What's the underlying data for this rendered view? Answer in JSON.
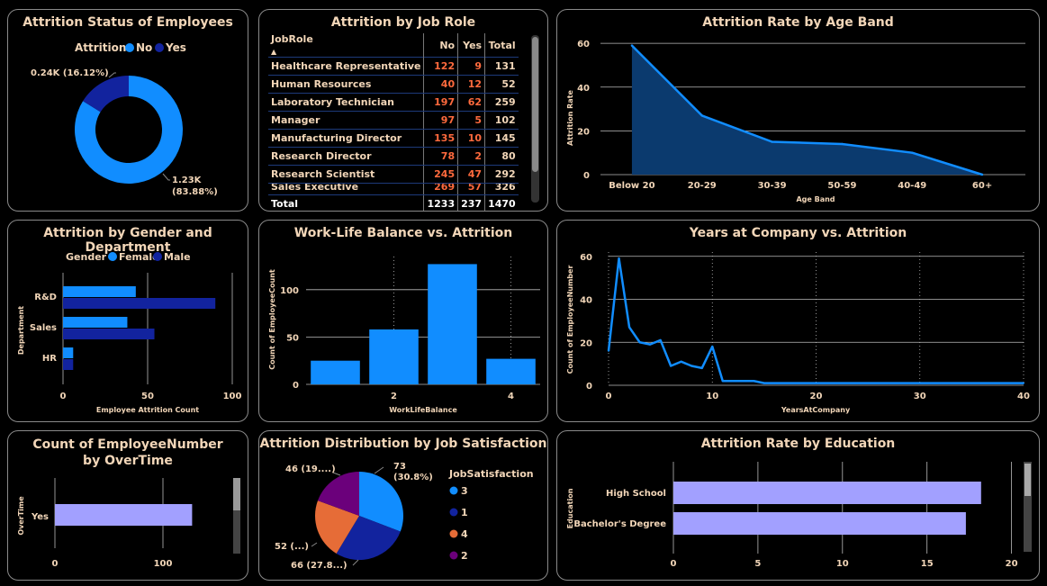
{
  "attrition_status": {
    "title": "Attrition Status of Employees",
    "legend_title": "Attrition",
    "legend_no": "No",
    "legend_yes": "Yes",
    "label_yes": "0.24K (16.12%)",
    "label_no_1": "1.23K",
    "label_no_2": "(83.88%)",
    "colors": {
      "No": "#118dff",
      "Yes": "#12239e"
    }
  },
  "job_role_table": {
    "title": "Attrition by Job Role",
    "headers": [
      "JobRole",
      "No",
      "Yes",
      "Total"
    ],
    "rows": [
      {
        "role": "Healthcare Representative",
        "no": "122",
        "yes": "9",
        "total": "131"
      },
      {
        "role": "Human Resources",
        "no": "40",
        "yes": "12",
        "total": "52"
      },
      {
        "role": "Laboratory Technician",
        "no": "197",
        "yes": "62",
        "total": "259"
      },
      {
        "role": "Manager",
        "no": "97",
        "yes": "5",
        "total": "102"
      },
      {
        "role": "Manufacturing Director",
        "no": "135",
        "yes": "10",
        "total": "145"
      },
      {
        "role": "Research Director",
        "no": "78",
        "yes": "2",
        "total": "80"
      },
      {
        "role": "Research Scientist",
        "no": "245",
        "yes": "47",
        "total": "292"
      },
      {
        "role": "Sales Executive",
        "no": "269",
        "yes": "57",
        "total": "326"
      }
    ],
    "total": {
      "label": "Total",
      "no": "1233",
      "yes": "237",
      "total": "1470"
    }
  },
  "chart_data": [
    {
      "type": "pie",
      "title": "Attrition Status of Employees",
      "donut": true,
      "slices": [
        {
          "name": "No",
          "value": 1233,
          "percent": 83.88
        },
        {
          "name": "Yes",
          "value": 237,
          "percent": 16.12
        }
      ]
    },
    {
      "type": "area",
      "title": "Attrition Rate by Age Band",
      "xlabel": "Age Band",
      "ylabel": "Attrition Rate",
      "categories": [
        "Below 20",
        "20-29",
        "30-39",
        "50-59",
        "40-49",
        "60+"
      ],
      "values": [
        59,
        27,
        15,
        14,
        10,
        0
      ],
      "ylim": [
        0,
        65
      ],
      "yticks": [
        0,
        20,
        40,
        60
      ],
      "grid": true,
      "color": "#118dff",
      "fill": "#0b3a6e"
    },
    {
      "type": "bar",
      "orientation": "horizontal",
      "title": "Attrition by Gender and Department",
      "legend_title": "Gender",
      "xlabel": "Employee Attrition Count",
      "ylabel": "Department",
      "categories": [
        "R&D",
        "Sales",
        "HR"
      ],
      "series": [
        {
          "name": "Female",
          "values": [
            43,
            38,
            6
          ],
          "color": "#118dff"
        },
        {
          "name": "Male",
          "values": [
            90,
            54,
            6
          ],
          "color": "#12239e"
        }
      ],
      "xlim": [
        0,
        100
      ],
      "xticks": [
        0,
        50,
        100
      ]
    },
    {
      "type": "bar",
      "title": "Work-Life Balance vs. Attrition",
      "xlabel": "WorkLifeBalance",
      "ylabel": "Count of EmployeeCount",
      "x": [
        1,
        2,
        3,
        4
      ],
      "values": [
        25,
        58,
        127,
        27
      ],
      "xticks": [
        2,
        4
      ],
      "yticks": [
        0,
        50,
        100
      ],
      "ylim": [
        0,
        135
      ],
      "color": "#118dff"
    },
    {
      "type": "line",
      "title": "Years at Company vs. Attrition",
      "xlabel": "YearsAtCompany",
      "ylabel": "Count of EmployeeNumber",
      "x": [
        0,
        1,
        2,
        3,
        4,
        5,
        6,
        7,
        8,
        9,
        10,
        11,
        12,
        13,
        14,
        15,
        16,
        17,
        18,
        19,
        20,
        21,
        22,
        23,
        24,
        25,
        26,
        27,
        28,
        29,
        30,
        31,
        32,
        33,
        34,
        35,
        36,
        37,
        38,
        39,
        40
      ],
      "values": [
        16,
        59,
        27,
        20,
        19,
        21,
        9,
        11,
        9,
        8,
        18,
        2,
        2,
        2,
        2,
        1,
        1,
        1,
        1,
        1,
        1,
        1,
        1,
        1,
        1,
        1,
        1,
        1,
        1,
        1,
        1,
        1,
        1,
        1,
        1,
        1,
        1,
        1,
        1,
        1,
        1
      ],
      "xticks": [
        0,
        10,
        20,
        30,
        40
      ],
      "yticks": [
        0,
        20,
        40,
        60
      ],
      "ylim": [
        0,
        62
      ],
      "color": "#118dff"
    },
    {
      "type": "bar",
      "orientation": "horizontal",
      "title": "Count of EmployeeNumber by OverTime",
      "ylabel": "OverTime",
      "categories": [
        "Yes"
      ],
      "values": [
        127
      ],
      "xticks": [
        0,
        100
      ],
      "xlim": [
        0,
        160
      ],
      "color": "#a2a0ff"
    },
    {
      "type": "pie",
      "title": "Attrition Distribution by Job Satisfaction",
      "legend_title": "JobSatisfaction",
      "legend": [
        "3",
        "1",
        "4",
        "2"
      ],
      "slices": [
        {
          "name": "3",
          "value": 73,
          "label": "73\n(30.8%)",
          "color": "#118dff"
        },
        {
          "name": "1",
          "value": 66,
          "label": "66 (27.8...)",
          "color": "#12239e"
        },
        {
          "name": "4",
          "value": 52,
          "label": "52 (...)",
          "color": "#e66c37"
        },
        {
          "name": "2",
          "value": 46,
          "label": "46 (19....)",
          "color": "#6b007b"
        }
      ]
    },
    {
      "type": "bar",
      "orientation": "horizontal",
      "title": "Attrition Rate by Education",
      "ylabel": "Education",
      "categories": [
        "High School",
        "Bachelor's Degree"
      ],
      "values": [
        18.2,
        17.3
      ],
      "xticks": [
        0,
        5,
        10,
        15,
        20
      ],
      "xlim": [
        0,
        20.5
      ],
      "color": "#a2a0ff"
    }
  ]
}
